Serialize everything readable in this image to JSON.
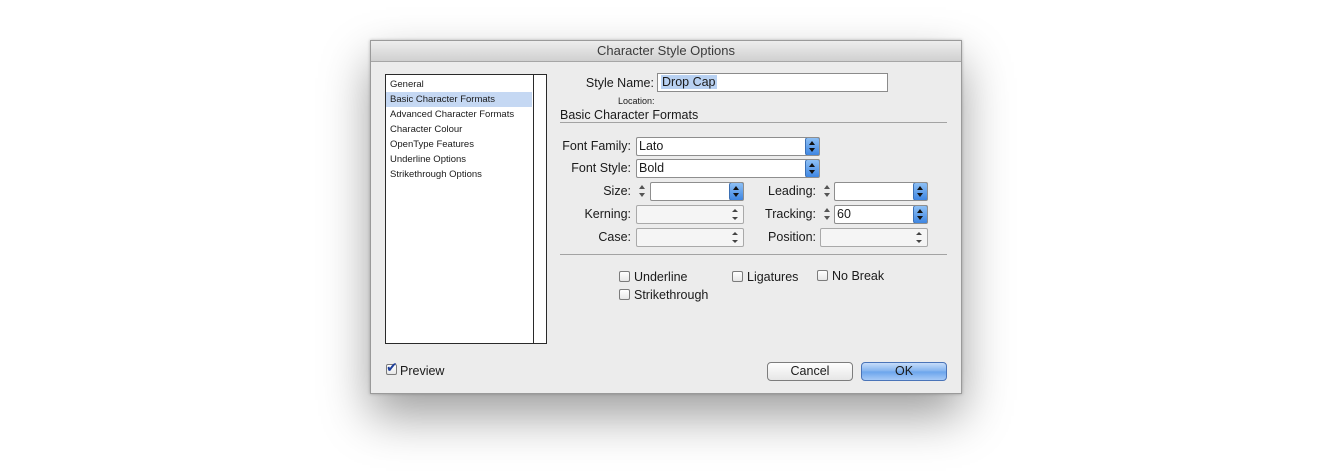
{
  "window": {
    "title": "Character Style Options"
  },
  "sidebar": {
    "items": [
      {
        "label": "General"
      },
      {
        "label": "Basic Character Formats"
      },
      {
        "label": "Advanced Character Formats"
      },
      {
        "label": "Character Colour"
      },
      {
        "label": "OpenType Features"
      },
      {
        "label": "Underline Options"
      },
      {
        "label": "Strikethrough Options"
      }
    ],
    "selected": "Basic Character Formats"
  },
  "style_name": {
    "label": "Style Name:",
    "value": "Drop Cap"
  },
  "location": {
    "label": "Location:"
  },
  "section": {
    "title": "Basic Character Formats"
  },
  "font_family": {
    "label": "Font Family:",
    "value": "Lato"
  },
  "font_style": {
    "label": "Font Style:",
    "value": "Bold"
  },
  "size": {
    "label": "Size:",
    "value": ""
  },
  "leading": {
    "label": "Leading:",
    "value": ""
  },
  "kerning": {
    "label": "Kerning:",
    "value": ""
  },
  "tracking": {
    "label": "Tracking:",
    "value": "60"
  },
  "case": {
    "label": "Case:",
    "value": ""
  },
  "position": {
    "label": "Position:",
    "value": ""
  },
  "checkboxes": {
    "underline": {
      "label": "Underline",
      "checked": false
    },
    "ligatures": {
      "label": "Ligatures",
      "checked": false
    },
    "no_break": {
      "label": "No Break",
      "checked": false
    },
    "strikethrough": {
      "label": "Strikethrough",
      "checked": false
    }
  },
  "preview": {
    "label": "Preview",
    "checked": true
  },
  "buttons": {
    "cancel": "Cancel",
    "ok": "OK"
  }
}
